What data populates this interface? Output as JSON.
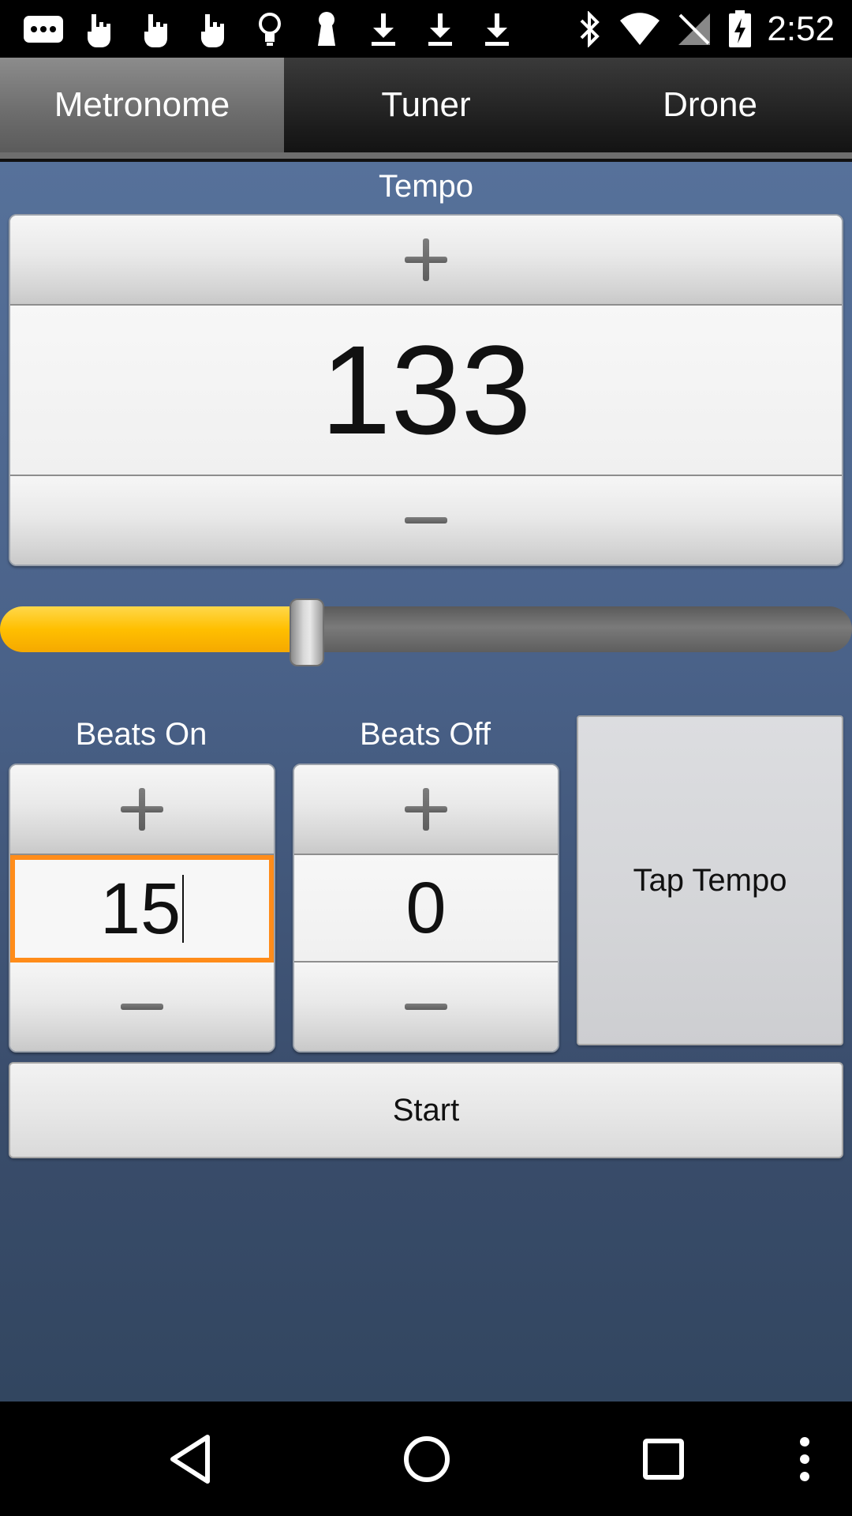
{
  "status_bar": {
    "time": "2:52",
    "left_icons": [
      "more-icon",
      "hand-icon",
      "hand-icon",
      "hand-icon",
      "lightbulb-icon",
      "keyhole-icon",
      "download-icon",
      "download-icon",
      "download-icon"
    ],
    "right_icons": [
      "bluetooth-icon",
      "wifi-icon",
      "no-signal-icon",
      "battery-charging-icon"
    ]
  },
  "tabs": [
    {
      "label": "Metronome",
      "active": true
    },
    {
      "label": "Tuner",
      "active": false
    },
    {
      "label": "Drone",
      "active": false
    }
  ],
  "tempo": {
    "label": "Tempo",
    "value": "133",
    "plus_icon": "plus-icon",
    "minus_icon": "minus-icon"
  },
  "slider": {
    "fraction": 0.34,
    "fill_color": "#ffbf00"
  },
  "beats_on": {
    "label": "Beats On",
    "value": "15"
  },
  "beats_off": {
    "label": "Beats Off",
    "value": "0"
  },
  "tap_tempo": {
    "label": "Tap Tempo"
  },
  "start": {
    "label": "Start"
  },
  "colors": {
    "accent_focus": "#ff8c1a",
    "background_top": "#56719a",
    "background_bottom": "#324660"
  },
  "nav_bar": {
    "icons": [
      "back-icon",
      "home-icon",
      "recents-icon",
      "overflow-menu-icon"
    ]
  }
}
